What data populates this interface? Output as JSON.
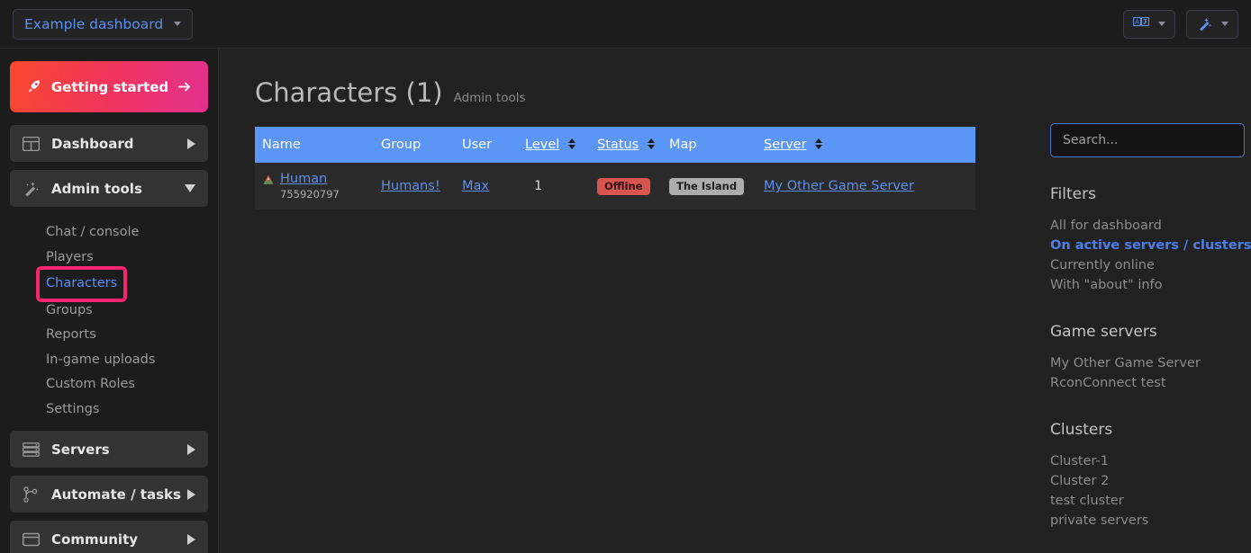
{
  "topbar": {
    "dashboard_select": "Example dashboard",
    "translate_button_icon": "translate-icon",
    "wand_button_icon": "magic-wand-icon"
  },
  "sidebar": {
    "getting_started": "Getting started",
    "groups": [
      {
        "label": "Dashboard",
        "icon": "grid-icon",
        "state": "collapsed"
      },
      {
        "label": "Admin tools",
        "icon": "magic-wand-icon",
        "state": "expanded"
      }
    ],
    "admin_tools_items": [
      {
        "label": "Chat / console",
        "active": false
      },
      {
        "label": "Players",
        "active": false
      },
      {
        "label": "Characters",
        "active": true,
        "highlighted": true
      },
      {
        "label": "Groups",
        "active": false
      },
      {
        "label": "Reports",
        "active": false
      },
      {
        "label": "In-game uploads",
        "active": false
      },
      {
        "label": "Custom Roles",
        "active": false
      },
      {
        "label": "Settings",
        "active": false
      }
    ],
    "bottom_groups": [
      {
        "label": "Servers",
        "icon": "server-rack-icon",
        "state": "collapsed"
      },
      {
        "label": "Automate / tasks",
        "icon": "git-branch-icon",
        "state": "collapsed"
      },
      {
        "label": "Community",
        "icon": "window-icon",
        "state": "collapsed"
      }
    ]
  },
  "main": {
    "title": "Characters (1)",
    "subtitle": "Admin tools",
    "table": {
      "columns": [
        {
          "label": "Name",
          "sortable": false
        },
        {
          "label": "Group",
          "sortable": false
        },
        {
          "label": "User",
          "sortable": false
        },
        {
          "label": "Level",
          "sortable": true
        },
        {
          "label": "Status",
          "sortable": true
        },
        {
          "label": "Map",
          "sortable": false
        },
        {
          "label": "Server",
          "sortable": true
        }
      ],
      "rows": [
        {
          "name": "Human",
          "name_icon": "ark-game-icon",
          "character_id": "755920797",
          "group": "Humans!",
          "user": "Max",
          "level": "1",
          "status": "Offline",
          "map": "The Island",
          "server": "My Other Game Server"
        }
      ]
    }
  },
  "rightpanel": {
    "search_placeholder": "Search...",
    "search_value": "",
    "filters_heading": "Filters",
    "filters": [
      {
        "label": "All for dashboard",
        "active": false
      },
      {
        "label": "On active servers / clusters",
        "active": true
      },
      {
        "label": "Currently online",
        "active": false
      },
      {
        "label": "With \"about\" info",
        "active": false
      }
    ],
    "game_servers_heading": "Game servers",
    "game_servers": [
      {
        "label": "My Other Game Server"
      },
      {
        "label": "RconConnect test"
      }
    ],
    "clusters_heading": "Clusters",
    "clusters": [
      {
        "label": "Cluster-1"
      },
      {
        "label": "Cluster 2"
      },
      {
        "label": "test cluster"
      },
      {
        "label": "private servers"
      }
    ]
  },
  "colors": {
    "accent_blue": "#5b8ff0",
    "table_header_blue": "#5b96f7",
    "highlight_pink": "#f4256d",
    "status_offline": "#d9534f",
    "map_badge": "#adadad"
  }
}
